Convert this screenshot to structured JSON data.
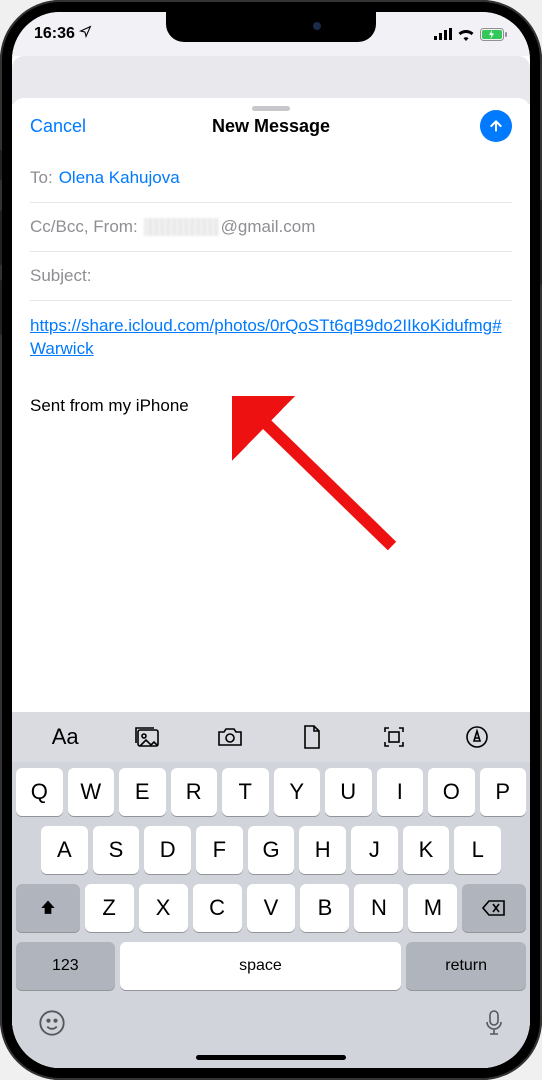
{
  "status": {
    "time": "16:36",
    "location_icon": "location-arrow"
  },
  "nav": {
    "cancel": "Cancel",
    "title": "New Message"
  },
  "fields": {
    "to_label": "To:",
    "to_value": "Olena Kahujova",
    "cc_label": "Cc/Bcc, From:",
    "from_suffix": "@gmail.com",
    "subject_label": "Subject:"
  },
  "body": {
    "link": "https://share.icloud.com/photos/0rQoSTt6qB9do2IIkoKidufmg#Warwick",
    "signature": "Sent from my iPhone"
  },
  "keyboard": {
    "row1": [
      "Q",
      "W",
      "E",
      "R",
      "T",
      "Y",
      "U",
      "I",
      "O",
      "P"
    ],
    "row2": [
      "A",
      "S",
      "D",
      "F",
      "G",
      "H",
      "J",
      "K",
      "L"
    ],
    "row3": [
      "Z",
      "X",
      "C",
      "V",
      "B",
      "N",
      "M"
    ],
    "numKey": "123",
    "spaceKey": "space",
    "returnKey": "return",
    "toolbar_icons": [
      "text-format",
      "photos",
      "camera",
      "document",
      "scan",
      "markup"
    ]
  }
}
